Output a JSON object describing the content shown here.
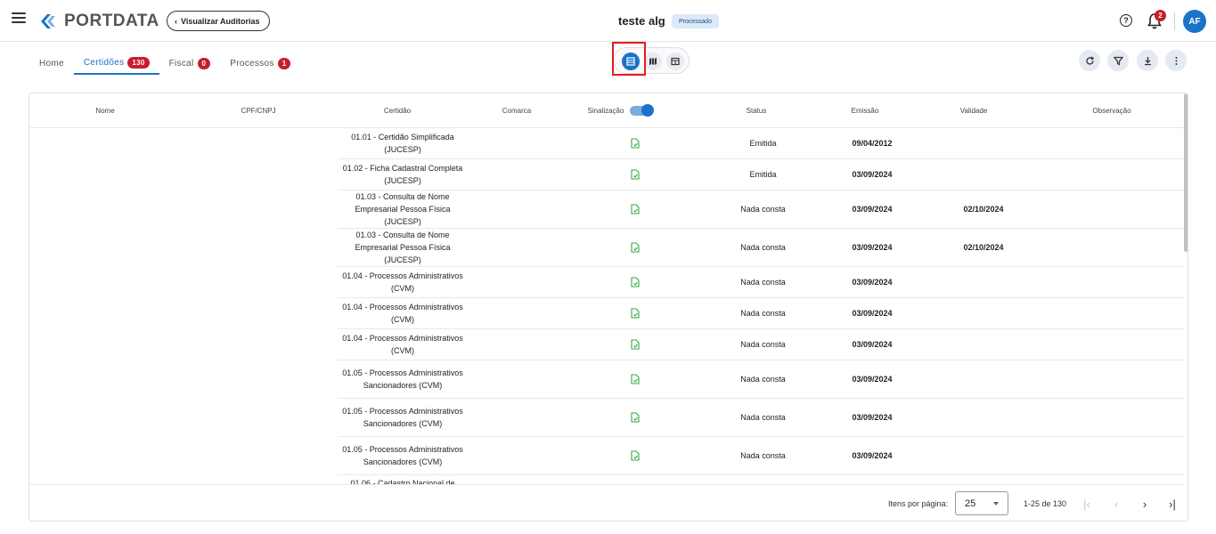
{
  "header": {
    "logo_text": "PORTDATA",
    "back_label": "Visualizar Auditorias",
    "title": "teste alg",
    "status": "Processado",
    "notifications_count": "2",
    "avatar_initials": "AF"
  },
  "tabs": [
    {
      "label": "Home",
      "count": null
    },
    {
      "label": "Certidões",
      "count": "130"
    },
    {
      "label": "Fiscal",
      "count": "0"
    },
    {
      "label": "Processos",
      "count": "1"
    }
  ],
  "table": {
    "columns": {
      "nome": "Nome",
      "cpf": "CPF/CNPJ",
      "certidao": "Certidão",
      "comarca": "Comarca",
      "sinalizacao": "Sinalização",
      "status": "Status",
      "emissao": "Emissão",
      "validade": "Validade",
      "observacao": "Observação"
    },
    "rows": [
      {
        "certidao": "01.01 - Certidão Simplificada (JUCESP)",
        "status": "Emitida",
        "emissao": "09/04/2012",
        "validade": ""
      },
      {
        "certidao": "01.02 - Ficha Cadastral Completa (JUCESP)",
        "status": "Emitida",
        "emissao": "03/09/2024",
        "validade": ""
      },
      {
        "certidao": "01.03 - Consulta de Nome Empresarial Pessoa Física (JUCESP)",
        "status": "Nada consta",
        "emissao": "03/09/2024",
        "validade": "02/10/2024"
      },
      {
        "certidao": "01.03 - Consulta de Nome Empresarial Pessoa Física (JUCESP)",
        "status": "Nada consta",
        "emissao": "03/09/2024",
        "validade": "02/10/2024"
      },
      {
        "certidao": "01.04 - Processos Administrativos (CVM)",
        "status": "Nada consta",
        "emissao": "03/09/2024",
        "validade": ""
      },
      {
        "certidao": "01.04 - Processos Administrativos (CVM)",
        "status": "Nada consta",
        "emissao": "03/09/2024",
        "validade": ""
      },
      {
        "certidao": "01.04 - Processos Administrativos (CVM)",
        "status": "Nada consta",
        "emissao": "03/09/2024",
        "validade": ""
      },
      {
        "certidao": "01.05 - Processos Administrativos Sancionadores (CVM)",
        "status": "Nada consta",
        "emissao": "03/09/2024",
        "validade": ""
      },
      {
        "certidao": "01.05 - Processos Administrativos Sancionadores (CVM)",
        "status": "Nada consta",
        "emissao": "03/09/2024",
        "validade": ""
      },
      {
        "certidao": "01.05 - Processos Administrativos Sancionadores (CVM)",
        "status": "Nada consta",
        "emissao": "03/09/2024",
        "validade": ""
      },
      {
        "certidao": "01.06 - Cadastro Nacional de",
        "status": "",
        "emissao": "",
        "validade": ""
      }
    ]
  },
  "paginator": {
    "items_label": "Itens por página:",
    "page_size": "25",
    "range": "1-25 de 130"
  },
  "colors": {
    "accent": "#1a73c8",
    "badge_red": "#c81d2a",
    "highlight": "#e31c1c"
  }
}
